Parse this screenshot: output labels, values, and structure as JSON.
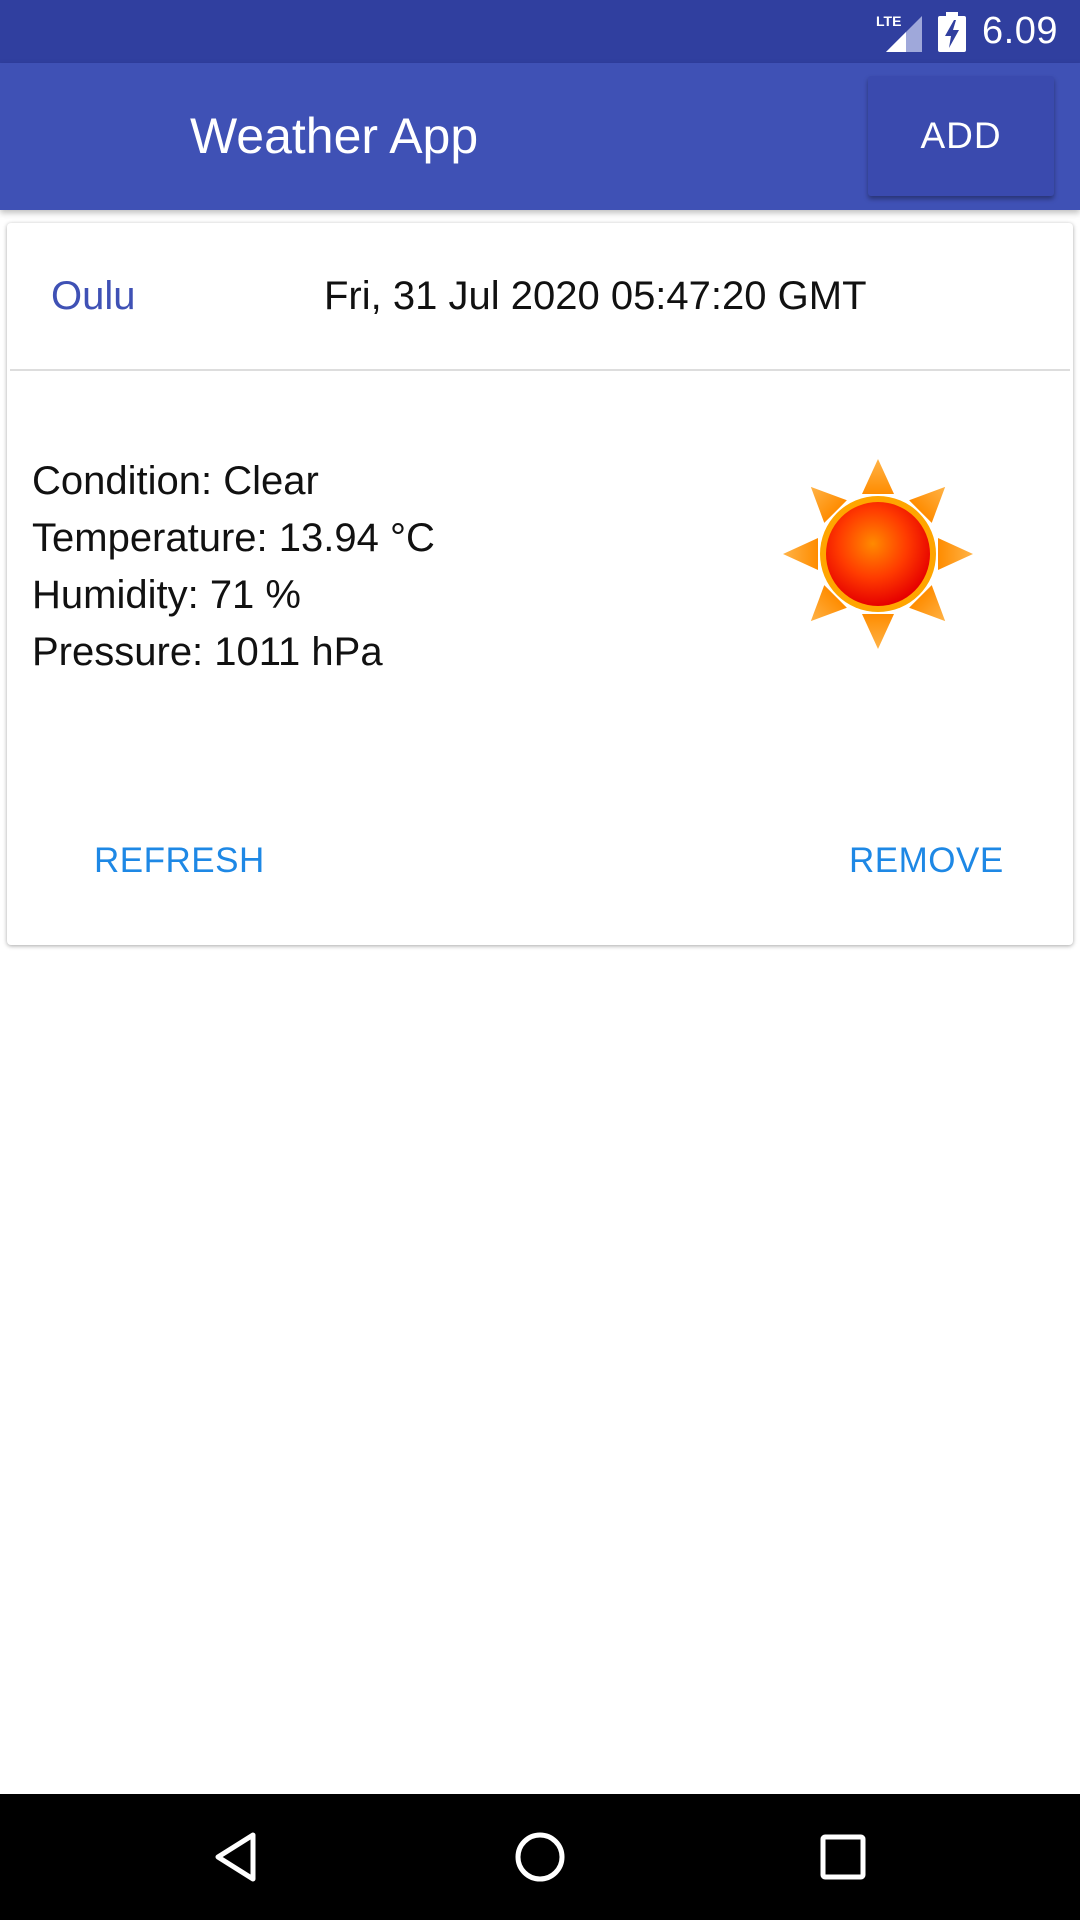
{
  "status_bar": {
    "network_label": "LTE",
    "time": "6.09",
    "icons": [
      "lte-signal-icon",
      "battery-charging-icon"
    ]
  },
  "app_bar": {
    "title": "Weather App",
    "add_label": "ADD"
  },
  "card": {
    "city": "Oulu",
    "timestamp": "Fri, 31 Jul 2020 05:47:20 GMT",
    "details": {
      "condition": "Condition: Clear",
      "temperature": "Temperature: 13.94 °C",
      "humidity": "Humidity: 71 %",
      "pressure": "Pressure: 1011 hPa"
    },
    "weather_icon": "sun-icon",
    "refresh_label": "REFRESH",
    "remove_label": "REMOVE"
  },
  "nav_bar": {
    "icons": [
      "back-icon",
      "home-icon",
      "recents-icon"
    ]
  },
  "colors": {
    "status_bar": "#303f9f",
    "app_bar": "#3f51b5",
    "city_text": "#3f51b5",
    "action_text": "#1e88e5",
    "nav_bar": "#000000"
  }
}
